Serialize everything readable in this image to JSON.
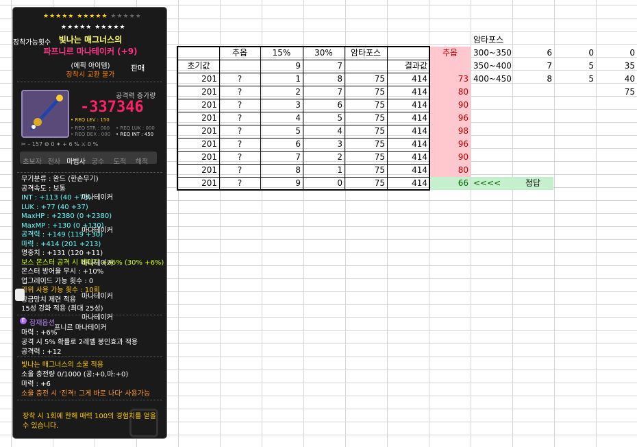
{
  "tooltip": {
    "stars_row1_on": "★★★★★ ★★★★★",
    "stars_row1_off": "★★★★★",
    "stars_row2_off": "★★★★★ ★★★★★",
    "title_line1": "빛나는 매그너스의",
    "title_line2": "파프니르 마나테이커 (+9)",
    "grade": "(에픽 아이템)",
    "trade": "장착시 교환 불가",
    "attack_increase_label": "공격력 증가량",
    "attack_increase_value": "-337346",
    "req_lev": "• REQ LEV : 150",
    "req_str": "• REQ STR : 000",
    "req_luk": "• REQ LUK : 000",
    "req_dex": "• REQ DEX : 000",
    "req_int": "• REQ INT : 450",
    "icons_row": "✂  – 157  ⚙      0  ✦  + 6 %  ⚔      0 %",
    "jobs": [
      "초보자",
      "전사",
      "마법사",
      "궁수",
      "도적",
      "해적"
    ],
    "stats": [
      {
        "text": "무기분류 : 완드 (한손무기)",
        "color": "#ffffff"
      },
      {
        "text": "공격속도 : 보통",
        "color": "#ffffff"
      },
      {
        "text": "INT : +113 (40 +73)",
        "color": "#66ffff"
      },
      {
        "text": "LUK : +77 (40 +37)",
        "color": "#66ffff"
      },
      {
        "text": "MaxHP : +2380 (0 +2380)",
        "color": "#66ffff"
      },
      {
        "text": "MaxMP : +130 (0 +130)",
        "color": "#66ffff"
      },
      {
        "text": "공격력 : +149 (119 +30)",
        "color": "#66ffff"
      },
      {
        "text": "마력 : +414 (201 +213)",
        "color": "#66ffff"
      },
      {
        "text": "명중치 : +131 (120 +11)",
        "color": "#ffffff"
      },
      {
        "text": "보스 몬스터 공격 시 데미지 +36% (30% +6%)",
        "color": "#ccff00"
      },
      {
        "text": "몬스터 방어율 무시 : +10%",
        "color": "#ffffff"
      },
      {
        "text": "업그레이드 가능 횟수 : 0",
        "color": "#ffffff"
      },
      {
        "text": "가위 사용 가능 횟수 : 10회",
        "color": "#ffcc00"
      },
      {
        "text": "황금망치 제련 적용",
        "color": "#ffffff"
      },
      {
        "text": "15성 강화 적용 (최대 25성)",
        "color": "#ffffff"
      }
    ],
    "potential_label": "잠재옵션",
    "potential": [
      "마력 : +6%",
      "공격 시 5% 확률로 2레벨 봉인효과 적용",
      "공격력 : +12"
    ],
    "soul_title": "빛나는 매그너스의 소울 적용",
    "soul_charge": "소울 충전량 0/1000 (공:+0,마:+0)",
    "soul_magic": "마력 : +6",
    "soul_skill": "소울 충전 시 '진격! 그게 바로 나다' 사용가능",
    "footer": [
      "장착 시 1회에 한해 매력 100의 경험치를 얻을",
      "수 있습니다."
    ],
    "ghost_texts": [
      "장착가능횟수",
      "판매",
      "마나테이커",
      "마나테이커",
      "마나테이커",
      "마나테이커",
      "마나테이커",
      "프니르 마나테이커"
    ]
  },
  "sheet": {
    "header_row": [
      "",
      "추옵",
      "15%",
      "30%",
      "암타포스",
      ""
    ],
    "second_row": [
      "초기값",
      "",
      "9",
      "7",
      "",
      "결과값"
    ],
    "rows": [
      [
        "201",
        "?",
        "1",
        "8",
        "75",
        "414",
        "73"
      ],
      [
        "201",
        "?",
        "2",
        "7",
        "75",
        "414",
        "80"
      ],
      [
        "201",
        "?",
        "3",
        "6",
        "75",
        "414",
        "90"
      ],
      [
        "201",
        "?",
        "4",
        "5",
        "75",
        "414",
        "96"
      ],
      [
        "201",
        "?",
        "5",
        "4",
        "75",
        "414",
        "98"
      ],
      [
        "201",
        "?",
        "6",
        "3",
        "75",
        "414",
        "96"
      ],
      [
        "201",
        "?",
        "7",
        "2",
        "75",
        "414",
        "90"
      ],
      [
        "201",
        "?",
        "8",
        "1",
        "75",
        "414",
        "80"
      ],
      [
        "201",
        "?",
        "9",
        "0",
        "75",
        "414",
        "66"
      ]
    ],
    "side_header": "추옵",
    "arrow": "<<<<",
    "answer": "정답",
    "amta_title": "암타포스",
    "amta_rows": [
      [
        "300~350",
        "6",
        "0",
        "0"
      ],
      [
        "350~400",
        "7",
        "5",
        "35"
      ],
      [
        "400~450",
        "8",
        "5",
        "40"
      ],
      [
        "",
        "",
        "",
        "75"
      ]
    ]
  }
}
